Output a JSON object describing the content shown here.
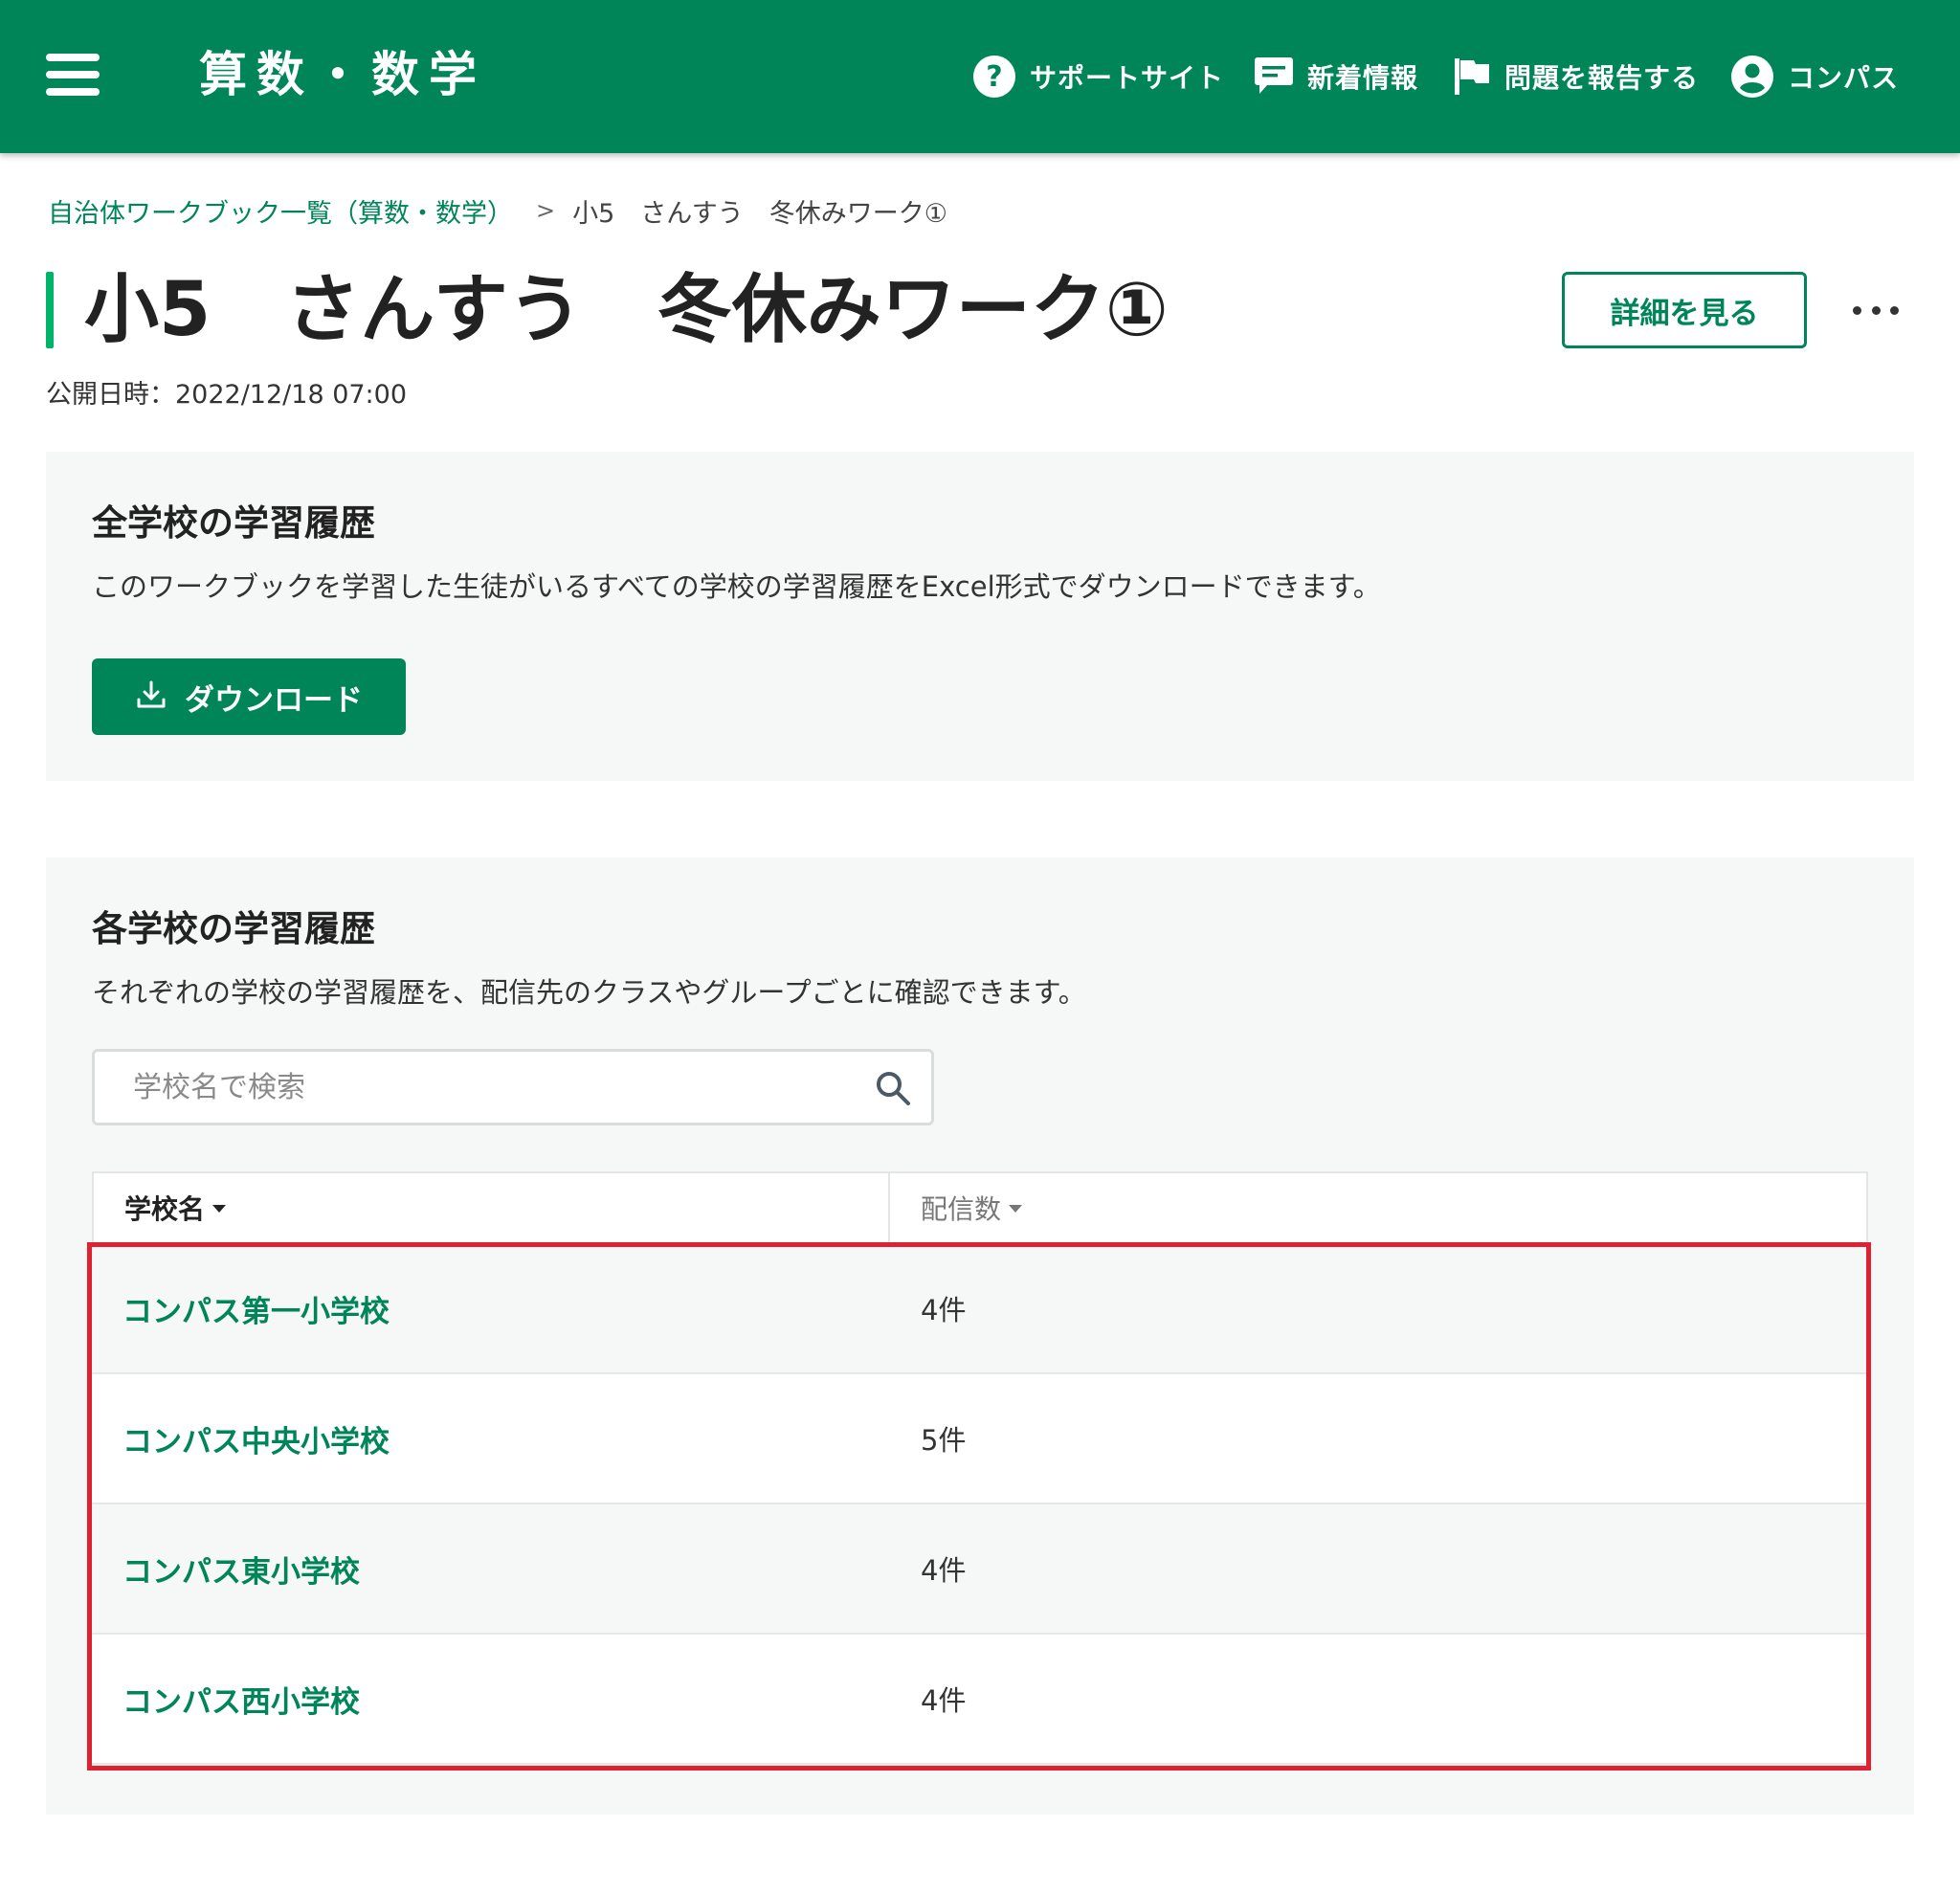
{
  "header": {
    "app_title": "算数・数学",
    "nav": {
      "support": "サポートサイト",
      "news": "新着情報",
      "report": "問題を報告する",
      "user": "コンパス"
    },
    "icons": [
      "menu-icon",
      "help-circle-icon",
      "message-icon",
      "flag-icon",
      "account-icon"
    ]
  },
  "breadcrumb": {
    "parent": "自治体ワークブック一覧（算数・数学）",
    "separator": ">",
    "current": "小5　さんすう　冬休みワーク①"
  },
  "page": {
    "title": "小5　さんすう　冬休みワーク①",
    "detail_button": "詳細を見る",
    "published": "公開日時：2022/12/18 07:00"
  },
  "all_schools": {
    "heading": "全学校の学習履歴",
    "description": "このワークブックを学習した生徒がいるすべての学校の学習履歴をExcel形式でダウンロードできます。",
    "download_button": "ダウンロード"
  },
  "each_school": {
    "heading": "各学校の学習履歴",
    "description": "それぞれの学校の学習履歴を、配信先のクラスやグループごとに確認できます。",
    "search_placeholder": "学校名で検索",
    "columns": {
      "name": "学校名",
      "count": "配信数"
    },
    "rows": [
      {
        "name": "コンパス第一小学校",
        "count": "4件"
      },
      {
        "name": "コンパス中央小学校",
        "count": "5件"
      },
      {
        "name": "コンパス東小学校",
        "count": "4件"
      },
      {
        "name": "コンパス西小学校",
        "count": "4件"
      }
    ]
  },
  "colors": {
    "brand": "#008558",
    "accent_bar": "#00b36b",
    "panel_bg": "#f6f7f7",
    "highlight": "#e0212f"
  }
}
